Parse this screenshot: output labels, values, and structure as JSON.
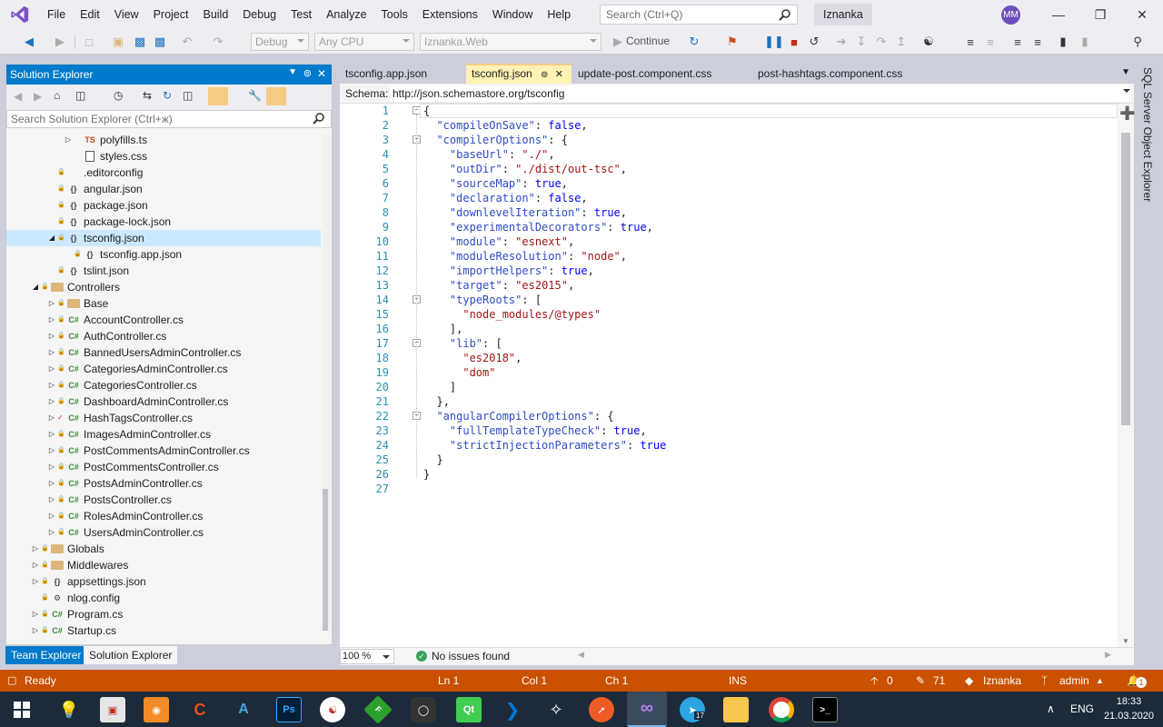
{
  "menubar": {
    "items": [
      "File",
      "Edit",
      "View",
      "Project",
      "Build",
      "Debug",
      "Test",
      "Analyze",
      "Tools",
      "Extensions",
      "Window",
      "Help"
    ],
    "search_placeholder": "Search (Ctrl+Q)",
    "solution_name": "Iznanka",
    "avatar_initials": "MM"
  },
  "toolbar": {
    "config": "Debug",
    "platform": "Any CPU",
    "startup_project": "Iznanka.Web",
    "continue_label": "Continue"
  },
  "solution_explorer": {
    "title": "Solution Explorer",
    "search_placeholder": "Search Solution Explorer (Ctrl+ж)",
    "items": [
      {
        "label": "polyfills.ts",
        "icon": "TS",
        "indent": 4,
        "expander": "right"
      },
      {
        "label": "styles.css",
        "icon": "css",
        "indent": 4,
        "expander": ""
      },
      {
        "label": ".editorconfig",
        "icon": "file",
        "indent": 3,
        "expander": ""
      },
      {
        "label": "angular.json",
        "icon": "json",
        "indent": 3,
        "expander": ""
      },
      {
        "label": "package.json",
        "icon": "json",
        "indent": 3,
        "expander": ""
      },
      {
        "label": "package-lock.json",
        "icon": "json",
        "indent": 3,
        "expander": ""
      },
      {
        "label": "tsconfig.json",
        "icon": "json",
        "indent": 3,
        "expander": "down",
        "selected": true
      },
      {
        "label": "tsconfig.app.json",
        "icon": "json",
        "indent": 4,
        "expander": ""
      },
      {
        "label": "tslint.json",
        "icon": "json",
        "indent": 3,
        "expander": ""
      },
      {
        "label": "Controllers",
        "icon": "folder",
        "indent": 2,
        "expander": "down"
      },
      {
        "label": "Base",
        "icon": "folder",
        "indent": 3,
        "expander": "right"
      },
      {
        "label": "AccountController.cs",
        "icon": "C#",
        "indent": 3,
        "expander": "right"
      },
      {
        "label": "AuthController.cs",
        "icon": "C#",
        "indent": 3,
        "expander": "right"
      },
      {
        "label": "BannedUsersAdminController.cs",
        "icon": "C#",
        "indent": 3,
        "expander": "right"
      },
      {
        "label": "CategoriesAdminController.cs",
        "icon": "C#",
        "indent": 3,
        "expander": "right"
      },
      {
        "label": "CategoriesController.cs",
        "icon": "C#",
        "indent": 3,
        "expander": "right"
      },
      {
        "label": "DashboardAdminController.cs",
        "icon": "C#",
        "indent": 3,
        "expander": "right"
      },
      {
        "label": "HashTagsController.cs",
        "icon": "C#",
        "indent": 3,
        "expander": "right",
        "modified": true
      },
      {
        "label": "ImagesAdminController.cs",
        "icon": "C#",
        "indent": 3,
        "expander": "right"
      },
      {
        "label": "PostCommentsAdminController.cs",
        "icon": "C#",
        "indent": 3,
        "expander": "right"
      },
      {
        "label": "PostCommentsController.cs",
        "icon": "C#",
        "indent": 3,
        "expander": "right"
      },
      {
        "label": "PostsAdminController.cs",
        "icon": "C#",
        "indent": 3,
        "expander": "right"
      },
      {
        "label": "PostsController.cs",
        "icon": "C#",
        "indent": 3,
        "expander": "right"
      },
      {
        "label": "RolesAdminController.cs",
        "icon": "C#",
        "indent": 3,
        "expander": "right"
      },
      {
        "label": "UsersAdminController.cs",
        "icon": "C#",
        "indent": 3,
        "expander": "right"
      },
      {
        "label": "Globals",
        "icon": "folder",
        "indent": 2,
        "expander": "right"
      },
      {
        "label": "Middlewares",
        "icon": "folder",
        "indent": 2,
        "expander": "right"
      },
      {
        "label": "appsettings.json",
        "icon": "json",
        "indent": 2,
        "expander": "right"
      },
      {
        "label": "nlog.config",
        "icon": "config",
        "indent": 2,
        "expander": ""
      },
      {
        "label": "Program.cs",
        "icon": "C#",
        "indent": 2,
        "expander": "right"
      },
      {
        "label": "Startup.cs",
        "icon": "C#",
        "indent": 2,
        "expander": "right"
      }
    ]
  },
  "bottom_tabs": [
    "Team Explorer",
    "Solution Explorer"
  ],
  "doc_tabs": [
    {
      "label": "tsconfig.app.json",
      "active": false
    },
    {
      "label": "tsconfig.json",
      "active": true
    },
    {
      "label": "update-post.component.css",
      "active": false
    },
    {
      "label": "post-hashtags.component.css",
      "active": false
    }
  ],
  "schema": {
    "label": "Schema:",
    "url": "http://json.schemastore.org/tsconfig"
  },
  "code_lines": [
    "{",
    "  \"compileOnSave\": false,",
    "  \"compilerOptions\": {",
    "    \"baseUrl\": \"./\",",
    "    \"outDir\": \"./dist/out-tsc\",",
    "    \"sourceMap\": true,",
    "    \"declaration\": false,",
    "    \"downlevelIteration\": true,",
    "    \"experimentalDecorators\": true,",
    "    \"module\": \"esnext\",",
    "    \"moduleResolution\": \"node\",",
    "    \"importHelpers\": true,",
    "    \"target\": \"es2015\",",
    "    \"typeRoots\": [",
    "      \"node_modules/@types\"",
    "    ],",
    "    \"lib\": [",
    "      \"es2018\",",
    "      \"dom\"",
    "    ]",
    "  },",
    "  \"angularCompilerOptions\": {",
    "    \"fullTemplateTypeCheck\": true,",
    "    \"strictInjectionParameters\": true",
    "  }",
    "}",
    ""
  ],
  "editor_footer": {
    "zoom": "100 %",
    "issues": "No issues found"
  },
  "statusbar": {
    "ready": "Ready",
    "ln": "Ln 1",
    "col": "Col 1",
    "ch": "Ch 1",
    "mode": "INS",
    "up_count": "0",
    "edit_count": "71",
    "repo": "Iznanka",
    "branch": "admin",
    "notif": "1"
  },
  "side_panel": "SQL Server Object Explorer",
  "taskbar": {
    "lang": "ENG",
    "time": "18:33",
    "date": "21.03.2020",
    "telegram_badge": "17"
  }
}
